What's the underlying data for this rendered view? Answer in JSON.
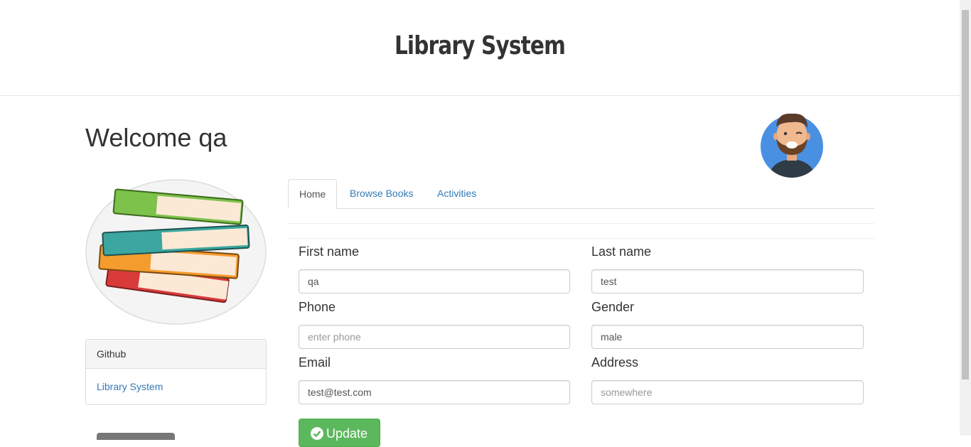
{
  "header": {
    "title": "Library System"
  },
  "welcome": "Welcome qa",
  "sidebar": {
    "panel_heading": "Github",
    "panel_link": "Library System"
  },
  "tabs": [
    {
      "label": "Home",
      "active": true
    },
    {
      "label": "Browse Books",
      "active": false
    },
    {
      "label": "Activities",
      "active": false
    }
  ],
  "form": {
    "first_name": {
      "label": "First name",
      "value": "qa",
      "placeholder": ""
    },
    "last_name": {
      "label": "Last name",
      "value": "test",
      "placeholder": ""
    },
    "phone": {
      "label": "Phone",
      "value": "",
      "placeholder": "enter phone"
    },
    "gender": {
      "label": "Gender",
      "value": "male",
      "placeholder": ""
    },
    "email": {
      "label": "Email",
      "value": "test@test.com",
      "placeholder": ""
    },
    "address": {
      "label": "Address",
      "value": "",
      "placeholder": "somewhere"
    },
    "submit_label": "Update"
  },
  "colors": {
    "link": "#337ab7",
    "success": "#5cb85c",
    "avatar_bg": "#4a90e2"
  }
}
